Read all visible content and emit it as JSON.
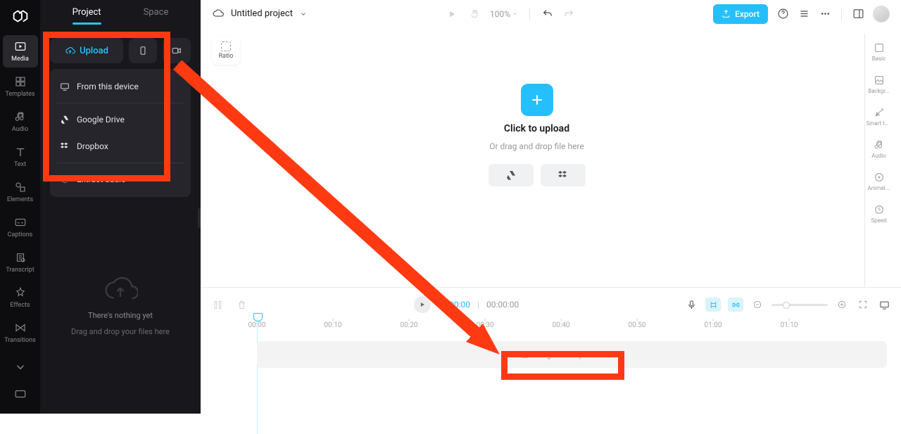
{
  "leftRail": {
    "items": [
      {
        "label": "Media",
        "icon": "media"
      },
      {
        "label": "Templates",
        "icon": "templates"
      },
      {
        "label": "Audio",
        "icon": "audio"
      },
      {
        "label": "Text",
        "icon": "text"
      },
      {
        "label": "Elements",
        "icon": "elements"
      },
      {
        "label": "Captions",
        "icon": "captions"
      },
      {
        "label": "Transcript",
        "icon": "transcript"
      },
      {
        "label": "Effects",
        "icon": "effects"
      },
      {
        "label": "Transitions",
        "icon": "transitions"
      }
    ],
    "activeIndex": 0
  },
  "panel": {
    "tabs": {
      "project": "Project",
      "space": "Space"
    },
    "upload": "Upload",
    "menu": {
      "fromDevice": "From this device",
      "googleDrive": "Google Drive",
      "dropbox": "Dropbox",
      "extractAudio": "Extract audio"
    },
    "empty": {
      "line1": "There's nothing yet",
      "line2": "Drag and drop your files here"
    }
  },
  "topbar": {
    "title": "Untitled project",
    "zoom": "100%",
    "export": "Export"
  },
  "canvas": {
    "ratioLabel": "Ratio",
    "uploadTitle": "Click to upload",
    "uploadSub": "Or drag and drop file here"
  },
  "propsRail": {
    "items": [
      {
        "label": "Basic"
      },
      {
        "label": "Backgr..."
      },
      {
        "label": "Smart tools"
      },
      {
        "label": "Audio"
      },
      {
        "label": "Animat..."
      },
      {
        "label": "Speed"
      }
    ]
  },
  "timeline": {
    "current": "00:00:00",
    "total": "00:00:00",
    "ticks": [
      "00:00",
      "00:10",
      "00:20",
      "00:30",
      "00:40",
      "00:50",
      "01:00",
      "01:10"
    ],
    "dropText": "Drag and drop media here"
  }
}
